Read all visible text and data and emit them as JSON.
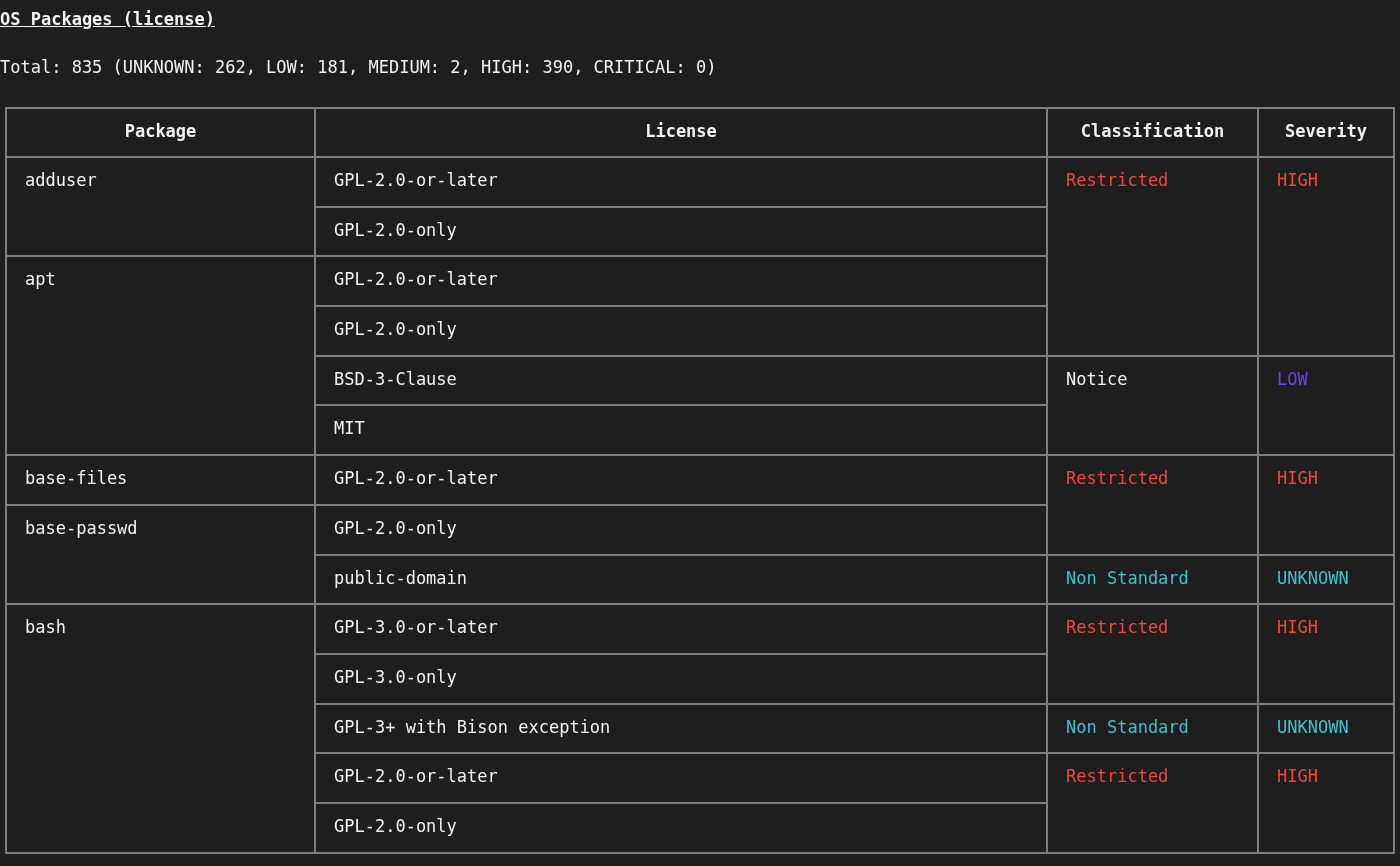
{
  "title": "OS Packages (license)",
  "summary": "Total: 835 (UNKNOWN: 262, LOW: 181, MEDIUM: 2, HIGH: 390, CRITICAL: 0)",
  "table": {
    "columns": [
      "Package",
      "License",
      "Classification",
      "Severity"
    ],
    "rows": [
      {
        "package": "adduser",
        "license": "GPL-2.0-or-later",
        "classification": {
          "text": "Restricted",
          "kind": "restricted"
        },
        "severity": {
          "text": "HIGH",
          "kind": "high"
        }
      },
      {
        "license": "GPL-2.0-only"
      },
      {
        "package": "apt",
        "license": "GPL-2.0-or-later"
      },
      {
        "license": "GPL-2.0-only"
      },
      {
        "license": "BSD-3-Clause",
        "classification": {
          "text": "Notice",
          "kind": "notice"
        },
        "severity": {
          "text": "LOW",
          "kind": "low"
        }
      },
      {
        "license": "MIT"
      },
      {
        "package": "base-files",
        "license": "GPL-2.0-or-later",
        "classification": {
          "text": "Restricted",
          "kind": "restricted"
        },
        "severity": {
          "text": "HIGH",
          "kind": "high"
        }
      },
      {
        "package": "base-passwd",
        "license": "GPL-2.0-only"
      },
      {
        "license": "public-domain",
        "classification": {
          "text": "Non Standard",
          "kind": "nonstandard"
        },
        "severity": {
          "text": "UNKNOWN",
          "kind": "unknown"
        }
      },
      {
        "package": "bash",
        "license": "GPL-3.0-or-later",
        "classification": {
          "text": "Restricted",
          "kind": "restricted"
        },
        "severity": {
          "text": "HIGH",
          "kind": "high"
        }
      },
      {
        "license": "GPL-3.0-only"
      },
      {
        "license": "GPL-3+ with Bison exception",
        "classification": {
          "text": "Non Standard",
          "kind": "nonstandard"
        },
        "severity": {
          "text": "UNKNOWN",
          "kind": "unknown"
        }
      },
      {
        "license": "GPL-2.0-or-later",
        "classification": {
          "text": "Restricted",
          "kind": "restricted"
        },
        "severity": {
          "text": "HIGH",
          "kind": "high"
        }
      },
      {
        "license": "GPL-2.0-only"
      }
    ]
  }
}
